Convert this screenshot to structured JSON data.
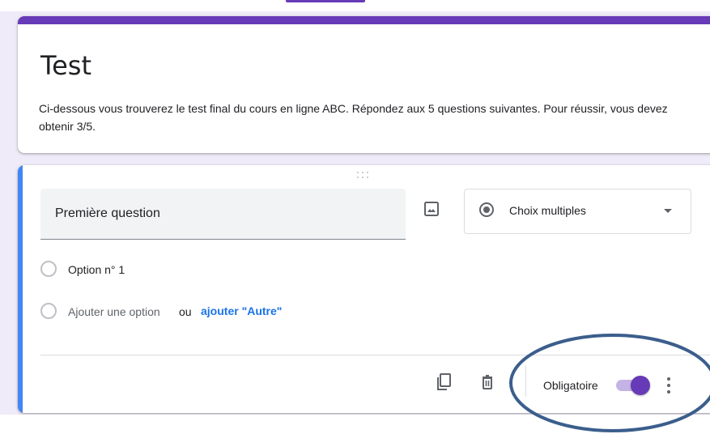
{
  "form": {
    "title": "Test",
    "description": "Ci-dessous vous trouverez le test final du cours en ligne ABC. Répondez aux 5 questions suivantes. Pour réussir, vous devez obtenir 3/5."
  },
  "question": {
    "text": "Première question",
    "type_label": "Choix multiples",
    "options": [
      {
        "label": "Option n° 1"
      }
    ],
    "add_option_label": "Ajouter une option",
    "or_label": "ou",
    "add_other_label": "ajouter \"Autre\"",
    "required_label": "Obligatoire",
    "required": true
  },
  "icons": [
    "drag-handle-icon",
    "image-icon",
    "radio-icon",
    "dropdown-arrow-icon",
    "duplicate-icon",
    "trash-icon",
    "more-vert-icon"
  ],
  "colors": {
    "theme": "#673ab7",
    "background": "#f0ebf8",
    "question_accent": "#4285f4",
    "link": "#1a73e8",
    "annotation": "#3b5e8c"
  }
}
